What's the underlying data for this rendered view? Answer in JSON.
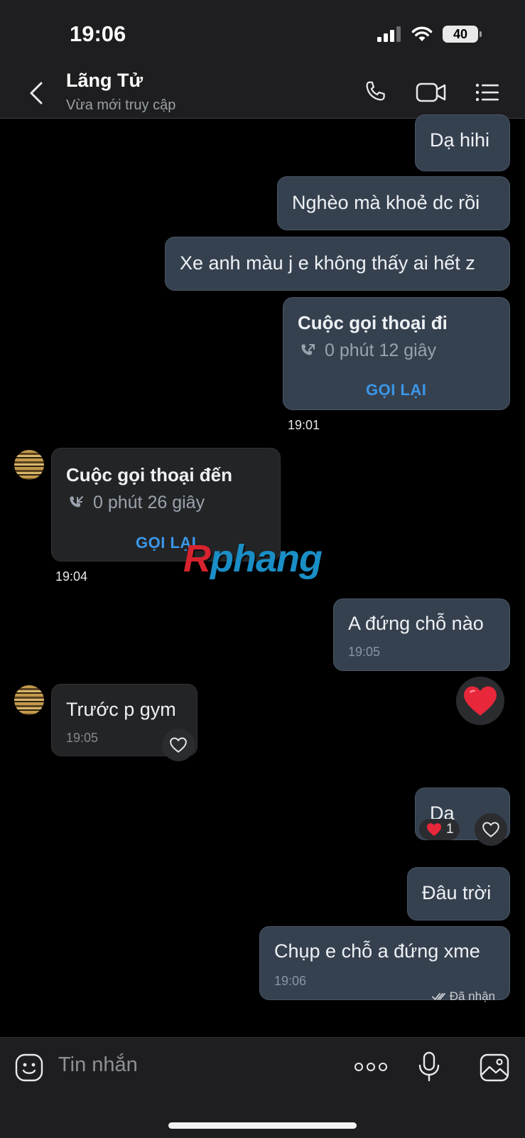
{
  "status_bar": {
    "time": "19:06",
    "battery": "40"
  },
  "header": {
    "name": "Lãng Tử",
    "status": "Vừa mới truy cập"
  },
  "messages": {
    "m1": {
      "text": "Dạ hihi"
    },
    "m2": {
      "text": "Nghèo mà khoẻ dc rồi"
    },
    "m3": {
      "text": "Xe anh màu j e không thấy ai hết z"
    },
    "call_out": {
      "title": "Cuộc gọi thoại đi",
      "duration": "0 phút 12 giây",
      "action": "GỌI LẠI",
      "time": "19:01"
    },
    "call_in": {
      "title": "Cuộc gọi thoại đến",
      "duration": "0 phút 26 giây",
      "action": "GỌI LẠI",
      "time": "19:04"
    },
    "m4": {
      "text": "A đứng chỗ nào",
      "time": "19:05"
    },
    "m5": {
      "text": "Trước p gym",
      "time": "19:05"
    },
    "m6": {
      "text": "Dạ",
      "reaction_count": "1"
    },
    "m7": {
      "text": "Đâu trời"
    },
    "m8": {
      "text": "Chụp e chỗ a đứng xme",
      "time": "19:06"
    },
    "receipt": "Đã nhận"
  },
  "watermark": {
    "part1": "R",
    "part2": "phang"
  },
  "composer": {
    "placeholder": "Tin nhắn"
  },
  "colors": {
    "outgoing_bubble": "#364150",
    "incoming_bubble": "#232426",
    "accent": "#3b97e8",
    "heart": "#e8273a"
  },
  "icons": [
    "back-icon",
    "phone-icon",
    "video-icon",
    "list-icon",
    "call-outgoing-icon",
    "call-incoming-icon",
    "heart-icon",
    "emoji-icon",
    "more-icon",
    "microphone-icon",
    "image-icon",
    "double-check-icon"
  ]
}
